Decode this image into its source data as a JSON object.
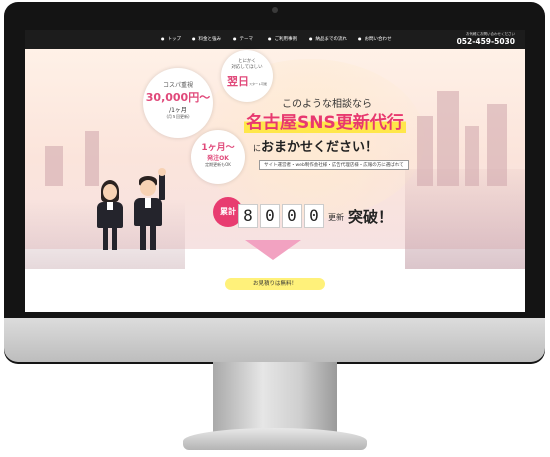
{
  "nav": {
    "items": [
      "トップ",
      "料金と強み",
      "テーマ",
      "ご利用事例",
      "納品までの流れ",
      "お問い合わせ"
    ],
    "phone_note": "お気軽にお問い合わせください",
    "phone": "052-459-5030"
  },
  "bubbles": {
    "cost": {
      "label": "コスパ重視",
      "price": "30,000円～",
      "per": "/1ヶ月",
      "note": "(月５回更新)"
    },
    "nextday": {
      "line1": "とにかく",
      "line2": "対応してほしい",
      "big": "翌日",
      "suffix": "スタート可能"
    },
    "onemonth": {
      "big": "1ヶ月～",
      "line2": "発注OK",
      "line3": "定期更新もOK"
    }
  },
  "headline": {
    "line1": "このような相談なら",
    "line2": "名古屋SNS更新代行",
    "line3_prefix": "に",
    "line3": "おまかせください！",
    "note": "サイト運営者・web制作会社様・広告代理店様・広報の方に選ばれて"
  },
  "counter": {
    "badge": "累計",
    "digits": [
      "8",
      "0",
      "0",
      "0"
    ],
    "unit": "更新",
    "suffix": "突破！"
  },
  "cta": {
    "estimate": "お見積りは無料！"
  },
  "colors": {
    "accent": "#e8386f",
    "highlight": "#ffe74a",
    "arrow": "#f2a2c1",
    "nav": "#1c1c1c"
  }
}
